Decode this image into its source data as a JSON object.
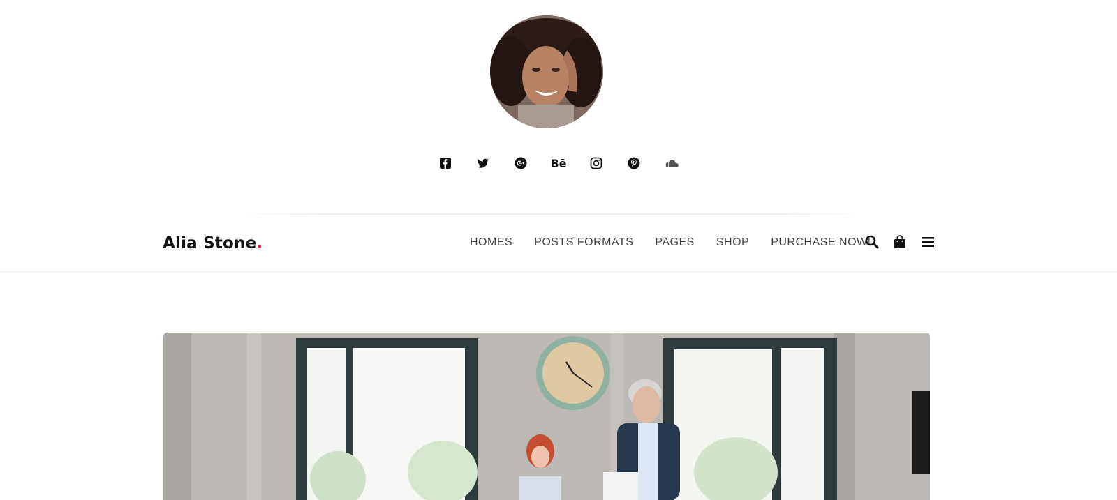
{
  "profile": {
    "avatar_alt": "Profile photo"
  },
  "social": [
    {
      "name": "facebook-icon"
    },
    {
      "name": "twitter-icon"
    },
    {
      "name": "google-plus-icon"
    },
    {
      "name": "behance-icon",
      "text": "Bē"
    },
    {
      "name": "instagram-icon"
    },
    {
      "name": "pinterest-icon"
    },
    {
      "name": "soundcloud-icon"
    }
  ],
  "header": {
    "logo": "Alia Stone",
    "logo_dot": ".",
    "logo_dot_color": "#e51b3b",
    "nav": [
      "HOMES",
      "POSTS FORMATS",
      "PAGES",
      "SHOP",
      "PURCHASE NOW!"
    ],
    "tools": [
      "search-icon",
      "shopping-bag-icon",
      "menu-icon"
    ]
  },
  "hero": {
    "alt": "Office scene with a wall clock, two colleagues reviewing documents"
  }
}
